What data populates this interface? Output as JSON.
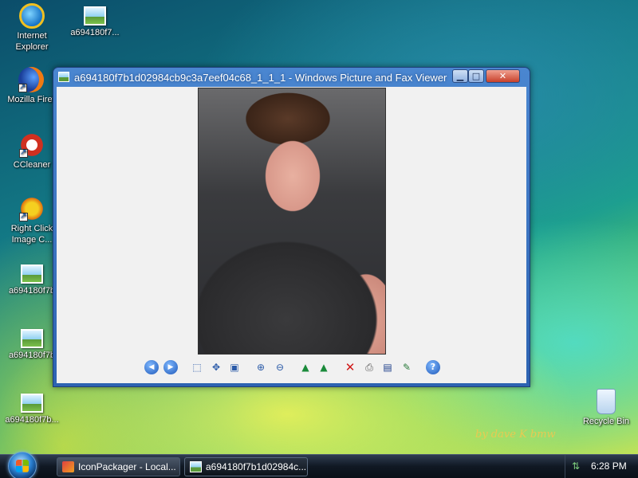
{
  "desktop": {
    "icons": [
      {
        "label": "Internet Explorer"
      },
      {
        "label": "a694180f7..."
      },
      {
        "label": "Mozilla Firef"
      },
      {
        "label": "CCleaner"
      },
      {
        "label": "Right Click Image C..."
      },
      {
        "label": "a694180f7b"
      },
      {
        "label": "a694180f7b"
      },
      {
        "label": "a694180f7b..."
      },
      {
        "label": "Recycle Bin"
      }
    ],
    "watermark": "by dave K bmw"
  },
  "window": {
    "title": "a694180f7b1d02984cb9c3a7eef04c68_1_1_1 - Windows Picture and Fax Viewer",
    "controls": {
      "minimize": "▁",
      "maximize": "□",
      "close": "✕"
    },
    "toolbar": [
      {
        "name": "previous-image-button",
        "icon": "◀"
      },
      {
        "name": "next-image-button",
        "icon": "▶"
      },
      {
        "name": "best-fit-button",
        "icon": "⬚"
      },
      {
        "name": "actual-size-button",
        "icon": "✥"
      },
      {
        "name": "slideshow-button",
        "icon": "▣"
      },
      {
        "name": "zoom-in-button",
        "icon": "⊕"
      },
      {
        "name": "zoom-out-button",
        "icon": "⊖"
      },
      {
        "name": "rotate-clockwise-button",
        "icon": "▲"
      },
      {
        "name": "rotate-counterclockwise-button",
        "icon": "▲"
      },
      {
        "name": "delete-button",
        "icon": "✕"
      },
      {
        "name": "print-button",
        "icon": "⎙"
      },
      {
        "name": "save-button",
        "icon": "▤"
      },
      {
        "name": "edit-button",
        "icon": "✎"
      },
      {
        "name": "help-button",
        "icon": "?"
      }
    ]
  },
  "taskbar": {
    "buttons": [
      {
        "label": "IconPackager - Local..."
      },
      {
        "label": "a694180f7b1d02984c..."
      }
    ],
    "clock": "6:28 PM"
  }
}
